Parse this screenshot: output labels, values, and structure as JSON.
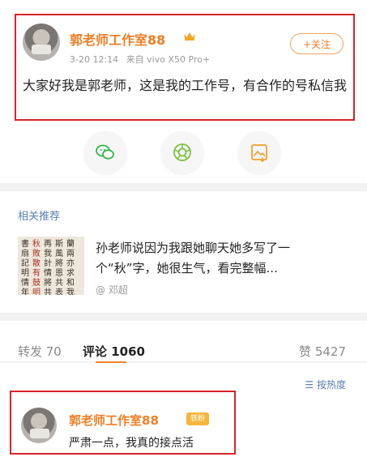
{
  "post": {
    "author_name": "郭老师工作室88",
    "crown_icon": "crown-icon",
    "timestamp": "3-20 12:14",
    "device": "来自 vivo X50 Pro+",
    "follow_label": "+关注",
    "text": "大家好我是郭老师，这是我的工作号，有合作的号私信我",
    "share_buttons": [
      "wechat-icon",
      "moments-icon",
      "save-image-icon"
    ]
  },
  "related": {
    "title": "相关推荐",
    "text": "孙老师说因为我跟她聊天她多写了一个“秋”字，她很生气，看完整幅...",
    "author": "@ 邓超"
  },
  "tabs": {
    "repost": "转发 70",
    "comment": "评论 1060",
    "likes": "赞 5427"
  },
  "comments": {
    "sort_label": "按热度",
    "items": [
      {
        "author": "郭老师工作室88",
        "badge": "铁粉",
        "text": "严肃一点，我真的接点活"
      }
    ]
  },
  "colors": {
    "accent": "#f07e25",
    "highlight_border": "#d8232a",
    "link": "#5b7fb0"
  }
}
